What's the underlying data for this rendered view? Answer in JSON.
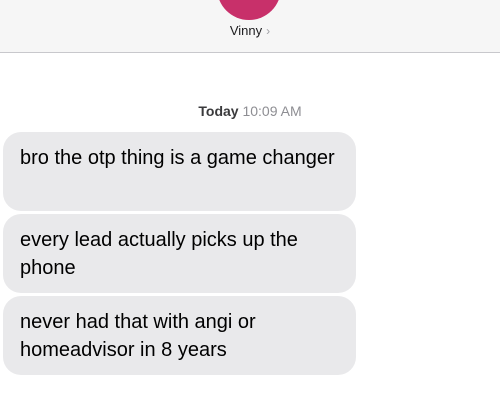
{
  "header": {
    "contact_name": "Vinny",
    "chevron": "›",
    "avatar_icon": "contact-avatar",
    "avatar_color": "#c8306a"
  },
  "conversation": {
    "timestamp_day": "Today",
    "timestamp_time": "10:09 AM",
    "messages": [
      {
        "sender": "incoming",
        "text": "bro the otp thing is a game changer"
      },
      {
        "sender": "incoming",
        "text": "every lead actually picks up the phone"
      },
      {
        "sender": "incoming",
        "text": "never had that with angi or homeadvisor in 8 years"
      }
    ]
  }
}
